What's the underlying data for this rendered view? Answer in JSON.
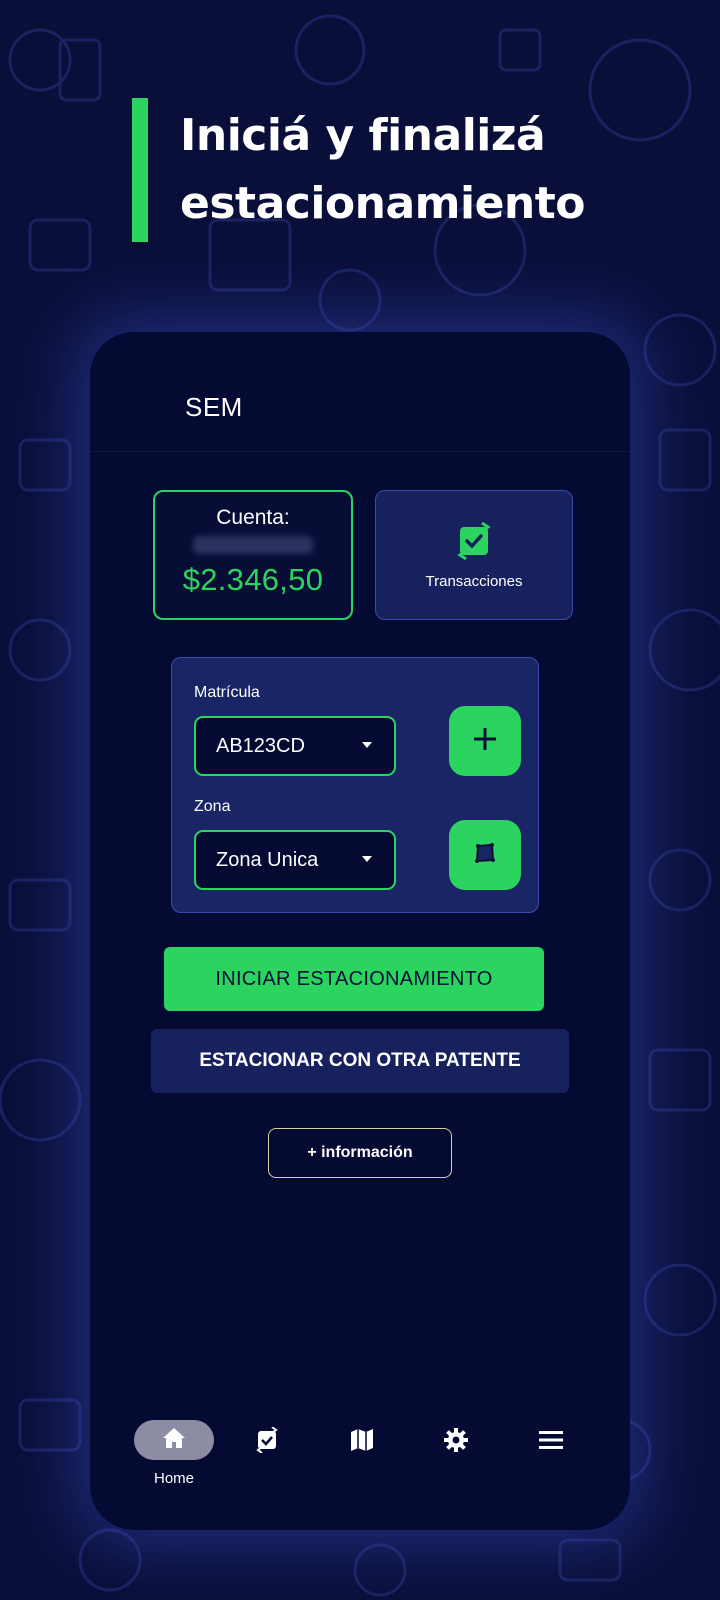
{
  "hero": {
    "title": "Iniciá y finalizá estacionamiento"
  },
  "app": {
    "title": "SEM"
  },
  "account": {
    "label": "Cuenta:",
    "balance": "$2.346,50"
  },
  "transactions": {
    "label": "Transacciones"
  },
  "form": {
    "plate_label": "Matrícula",
    "plate_value": "AB123CD",
    "zone_label": "Zona",
    "zone_value": "Zona Unica"
  },
  "actions": {
    "start": "INICIAR ESTACIONAMIENTO",
    "other_plate": "ESTACIONAR CON OTRA PATENTE",
    "more_info": "+ información"
  },
  "nav": {
    "items": [
      {
        "label": "Home",
        "icon": "home-icon",
        "active": true
      },
      {
        "icon": "transactions-icon"
      },
      {
        "icon": "map-icon"
      },
      {
        "icon": "gear-icon"
      },
      {
        "icon": "menu-icon"
      }
    ]
  },
  "colors": {
    "accent": "#2bd35f",
    "background": "#0a0f3a",
    "panel": "#1a2565"
  }
}
